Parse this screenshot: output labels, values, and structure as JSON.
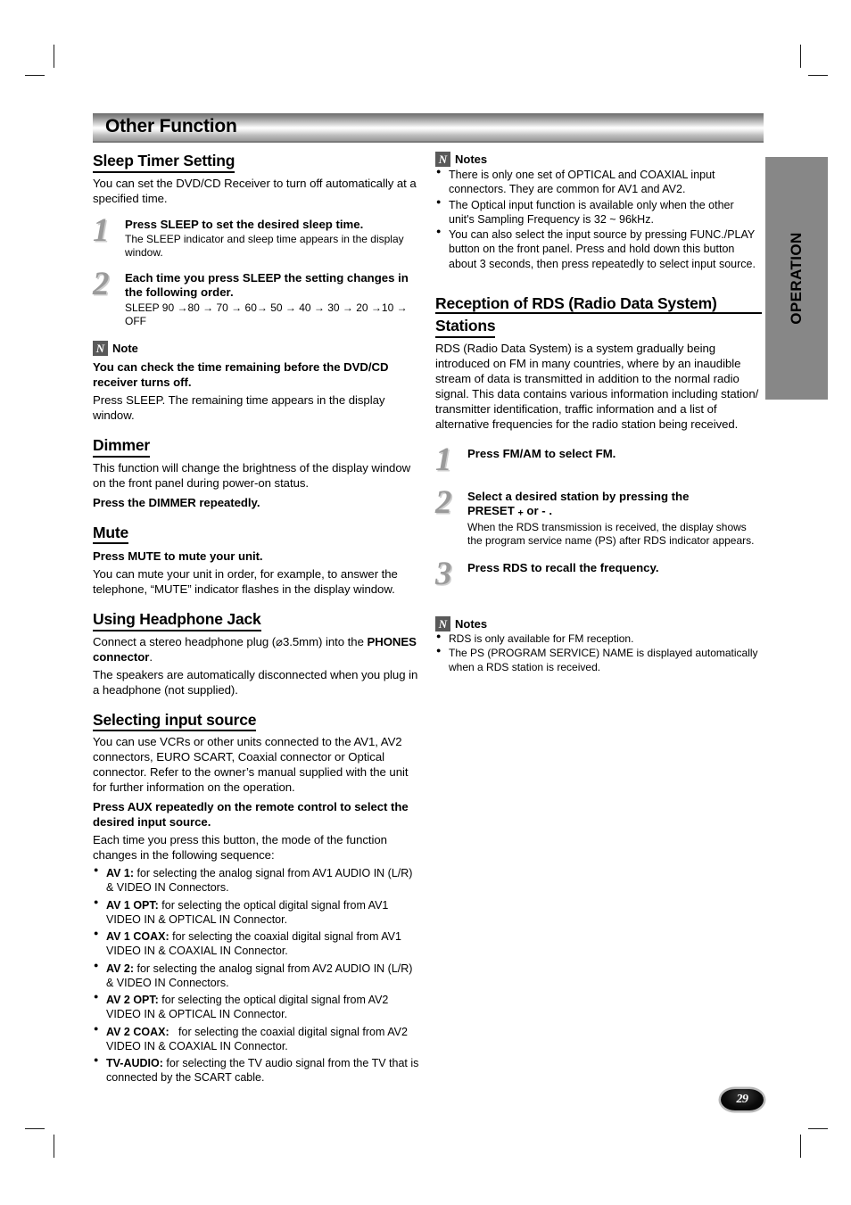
{
  "banner": {
    "title": "Other Function"
  },
  "side_tab": {
    "label": "OPERATION"
  },
  "page_badge": {
    "number": "29"
  },
  "icons": {
    "note_glyph": "N"
  },
  "left_column": {
    "sleep_timer": {
      "heading": "Sleep Timer Setting",
      "intro": "You can set the DVD/CD Receiver to turn off automatically at a specified time.",
      "steps": [
        {
          "number": "1",
          "head": "Press SLEEP to set the desired sleep time.",
          "body": "The SLEEP indicator and sleep time appears in the display window."
        },
        {
          "number": "2",
          "head": "Each time you press SLEEP the setting changes in the following order.",
          "body": "SLEEP  90 →80 → 70 → 60→ 50 → 40 → 30 → 20 →10 → OFF"
        }
      ],
      "note": {
        "title": "Note",
        "bold_line": "You can check the time remaining before the DVD/CD receiver turns off.",
        "body": "Press SLEEP. The remaining time appears in the display window."
      }
    },
    "dimmer": {
      "heading": "Dimmer",
      "body": "This function will change the brightness of the display window on the front panel during power-on status.",
      "action": "Press the DIMMER repeatedly."
    },
    "mute": {
      "heading": "Mute",
      "action": "Press MUTE to mute your unit.",
      "body": "You can mute your unit in order, for example, to answer the telephone, “MUTE” indicator flashes in the display window."
    },
    "headphone": {
      "heading": "Using Headphone Jack",
      "body_pre": "Connect a stereo headphone plug (⌀3.5mm) into the ",
      "body_bold": "PHONES connector",
      "body_post": ".",
      "body2": "The speakers are automatically disconnected when you plug in a headphone (not supplied)."
    },
    "input_source": {
      "heading": "Selecting input source",
      "body": "You can use VCRs or other units connected to the AV1, AV2 connectors, EURO SCART, Coaxial connector or Optical connector. Refer to the owner’s manual supplied with the unit for further information on the operation.",
      "action": "Press AUX repeatedly on the remote control to select the desired input source.",
      "body2": "Each time you press this button, the mode of the function changes in the following sequence:",
      "items": [
        {
          "label": "AV 1:",
          "text": " for selecting the analog signal from AV1 AUDIO IN (L/R) & VIDEO IN Connectors."
        },
        {
          "label": "AV 1 OPT:",
          "text": " for selecting the optical digital signal from AV1 VIDEO IN & OPTICAL IN Connector."
        },
        {
          "label": "AV 1 COAX:",
          "text": " for selecting the coaxial digital signal from AV1 VIDEO IN & COAXIAL IN Connector."
        },
        {
          "label": "AV 2:",
          "text": " for selecting the analog signal from AV2 AUDIO IN (L/R) & VIDEO IN Connectors."
        },
        {
          "label": "AV 2 OPT:",
          "text": " for selecting the optical digital signal from AV2 VIDEO IN & OPTICAL IN Connector."
        },
        {
          "label": "AV 2 COAX:",
          "text": "   for selecting the coaxial digital signal from AV2 VIDEO IN & COAXIAL IN Connector."
        },
        {
          "label": "TV-AUDIO:",
          "text": " for selecting the TV audio signal from the TV that is connected by the SCART cable."
        }
      ]
    }
  },
  "right_column": {
    "notes_top": {
      "title": "Notes",
      "items": [
        "There is only one set of OPTICAL and COAXIAL input connectors. They are common for AV1 and AV2.",
        "The Optical input function is available only when the other unit's Sampling Frequency is 32 ~ 96kHz.",
        "You can also select the input source by pressing FUNC./PLAY button on the front panel. Press and hold down this button about 3 seconds, then press repeatedly to select input source."
      ]
    },
    "rds": {
      "heading_line1": "Reception of RDS (Radio Data System)",
      "heading_line2": "Stations",
      "body": "RDS (Radio Data System) is a system gradually being introduced on FM in many countries, where by an inaudible stream of data is transmitted in addition to the normal radio signal. This data contains various information including station/ transmitter identification, traffic information and a list of alternative frequencies for the radio station being received.",
      "steps": [
        {
          "number": "1",
          "head": "Press FM/AM to select FM.",
          "body": ""
        },
        {
          "number": "2",
          "head_line1": "Select a desired station by pressing the",
          "head_line2_pre": "PRESET ",
          "head_line2_plus": "+",
          "head_line2_mid": " or - .",
          "body": "When the RDS transmission is received, the display shows the program service name (PS) after RDS indicator appears."
        },
        {
          "number": "3",
          "head": "Press RDS to recall the frequency.",
          "body": ""
        }
      ],
      "notes": {
        "title": "Notes",
        "items": [
          " RDS is only available for FM reception.",
          "The PS (PROGRAM SERVICE) NAME is displayed automatically when a RDS station is received."
        ]
      }
    }
  }
}
